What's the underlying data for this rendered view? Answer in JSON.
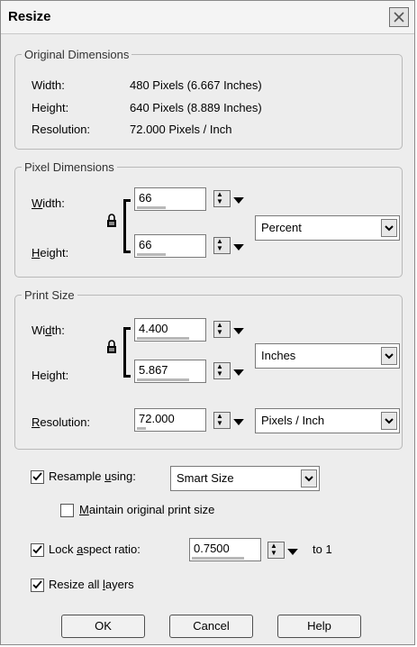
{
  "dialog": {
    "title": "Resize",
    "close_icon": "close-x-icon"
  },
  "original": {
    "legend": "Original Dimensions",
    "width_label": "Width:",
    "width_value": "480 Pixels (6.667 Inches)",
    "height_label": "Height:",
    "height_value": "640 Pixels (8.889 Inches)",
    "resolution_label": "Resolution:",
    "resolution_value": "72.000 Pixels / Inch"
  },
  "pixel": {
    "legend": "Pixel Dimensions",
    "width_label_u": "W",
    "width_label_rest": "idth:",
    "height_label_u": "H",
    "height_label_rest": "eight:",
    "width_value": "66",
    "height_value": "66",
    "unit_selected": "Percent"
  },
  "print": {
    "legend": "Print Size",
    "width_label_pre": "Wi",
    "width_label_u": "d",
    "width_label_rest": "th:",
    "height_label_pre": "Hei",
    "height_label_u": "g",
    "height_label_rest": "ht:",
    "width_value": "4.400",
    "height_value": "5.867",
    "unit_selected": "Inches",
    "resolution_label_u": "R",
    "resolution_label_rest": "esolution:",
    "resolution_value": "72.000",
    "resolution_unit_selected": "Pixels / Inch"
  },
  "options": {
    "resample_pre": "Resample ",
    "resample_u": "u",
    "resample_rest": "sing:",
    "resample_checked": true,
    "resample_method": "Smart Size",
    "maintain_u": "M",
    "maintain_rest": "aintain original print size",
    "maintain_checked": false,
    "lock_pre": "Lock ",
    "lock_u": "a",
    "lock_rest": "spect ratio:",
    "lock_checked": true,
    "ratio_value": "0.7500",
    "ratio_suffix": "to 1",
    "resize_pre": "Resize all ",
    "resize_u": "l",
    "resize_rest": "ayers",
    "resize_checked": true
  },
  "buttons": {
    "ok": "OK",
    "cancel": "Cancel",
    "help": "Help"
  }
}
